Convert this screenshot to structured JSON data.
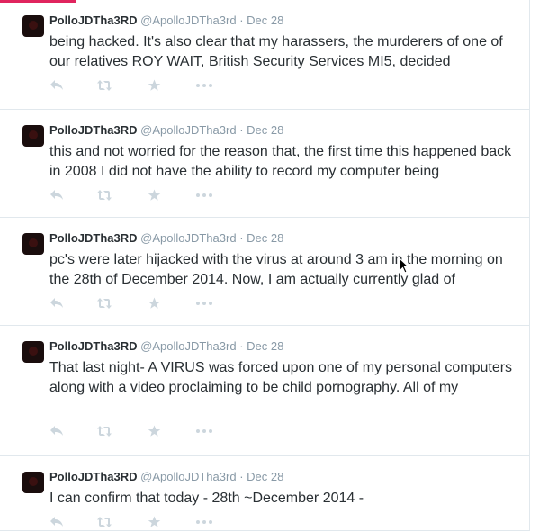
{
  "tweets": [
    {
      "name": "PolloJDTha3RD",
      "handle": "@ApolloJDTha3rd",
      "separator": "·",
      "time": "Dec 28",
      "text": "being hacked.  It's also clear that my harassers,  the murderers of one of our relatives ROY WAIT, British Security Services MI5,  decided"
    },
    {
      "name": "PolloJDTha3RD",
      "handle": "@ApolloJDTha3rd",
      "separator": "·",
      "time": "Dec 28",
      "text": "this and not worried for the reason that, the first time this happened back in 2008 I did not have the ability to record my computer being"
    },
    {
      "name": "PolloJDTha3RD",
      "handle": "@ApolloJDTha3rd",
      "separator": "·",
      "time": "Dec 28",
      "text": "pc's were later hijacked with the virus at around 3 am in the morning on the 28th of December 2014.   Now, I am actually currently glad of"
    },
    {
      "name": "PolloJDTha3RD",
      "handle": "@ApolloJDTha3rd",
      "separator": "·",
      "time": "Dec 28",
      "text": "That last night-  A VIRUS was forced  upon one of my  personal computers along with a video proclaiming to be child pornography.  All of my"
    },
    {
      "name": "PolloJDTha3RD",
      "handle": "@ApolloJDTha3rd",
      "separator": "·",
      "time": "Dec 28",
      "text": "I can confirm that today - 28th ~December 2014 -"
    }
  ],
  "icons": {
    "reply": "reply-icon",
    "retweet": "retweet-icon",
    "favorite": "star-icon",
    "more": "more-icon"
  },
  "colors": {
    "text": "#292f33",
    "meta": "#8899a6",
    "action_icon": "#ccd6dd",
    "divider": "#e1e8ed",
    "accent": "#e0245e"
  }
}
